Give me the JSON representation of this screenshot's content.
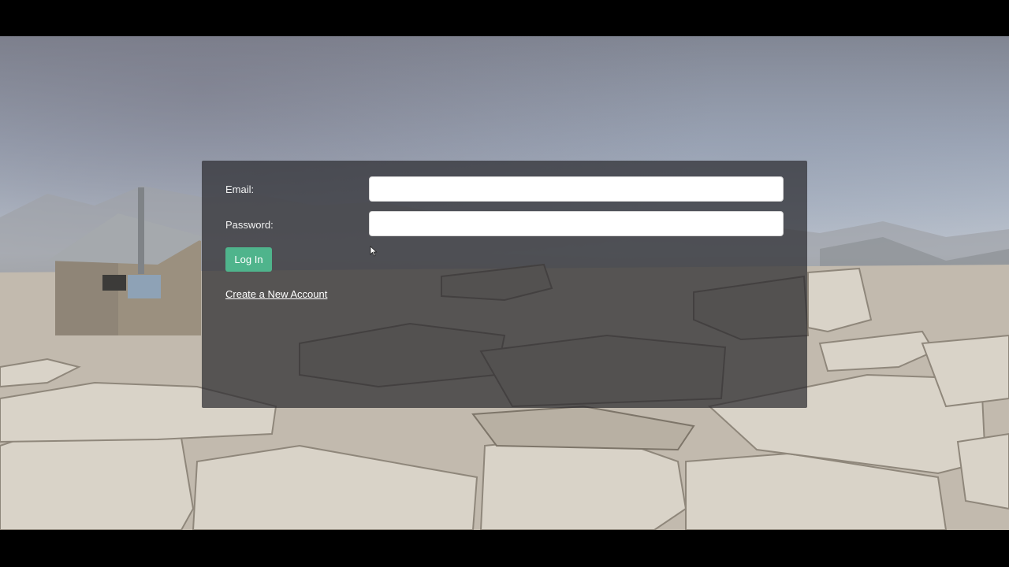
{
  "login": {
    "email_label": "Email:",
    "email_value": "",
    "password_label": "Password:",
    "password_value": "",
    "login_button": "Log In",
    "create_account_link": "Create a New Account"
  },
  "colors": {
    "button": "#4fb48c",
    "panel": "rgba(45,44,48,0.72)"
  },
  "background": {
    "description_icon": "mountain-summit-hut-photo"
  }
}
